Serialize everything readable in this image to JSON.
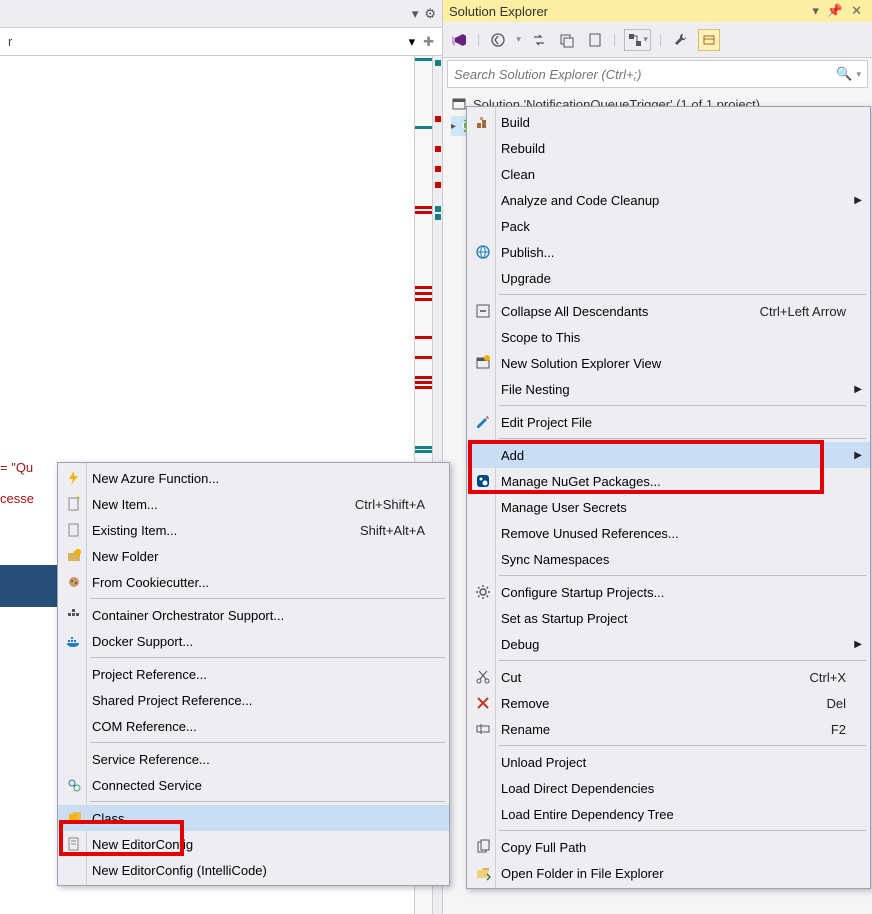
{
  "window": {
    "dropdown_chevron": "▾",
    "gear_icon": "⚙"
  },
  "nav": {
    "breadcrumb": "r",
    "plus": "✚"
  },
  "code": {
    "quote_fragment": "= \"Qu",
    "essed": "cesse"
  },
  "solution_explorer": {
    "title": "Solution Explorer",
    "search_placeholder": "Search Solution Explorer (Ctrl+;)",
    "solution_line": "Solution 'NotificationQueueTrigger' (1 of 1 project)"
  },
  "main_menu": {
    "build": "Build",
    "rebuild": "Rebuild",
    "clean": "Clean",
    "analyze": "Analyze and Code Cleanup",
    "pack": "Pack",
    "publish": "Publish...",
    "upgrade": "Upgrade",
    "collapse": "Collapse All Descendants",
    "collapse_sc": "Ctrl+Left Arrow",
    "scope": "Scope to This",
    "new_se_view": "New Solution Explorer View",
    "file_nesting": "File Nesting",
    "edit_proj": "Edit Project File",
    "add": "Add",
    "nuget": "Manage NuGet Packages...",
    "secrets": "Manage User Secrets",
    "remove_unused": "Remove Unused References...",
    "sync_ns": "Sync Namespaces",
    "cfg_startup": "Configure Startup Projects...",
    "set_startup": "Set as Startup Project",
    "debug": "Debug",
    "cut": "Cut",
    "cut_sc": "Ctrl+X",
    "remove": "Remove",
    "remove_sc": "Del",
    "rename": "Rename",
    "rename_sc": "F2",
    "unload": "Unload Project",
    "load_direct": "Load Direct Dependencies",
    "load_tree": "Load Entire Dependency Tree",
    "copy_path": "Copy Full Path",
    "open_explorer": "Open Folder in File Explorer"
  },
  "add_menu": {
    "new_azure": "New Azure Function...",
    "new_item": "New Item...",
    "new_item_sc": "Ctrl+Shift+A",
    "existing_item": "Existing Item...",
    "existing_item_sc": "Shift+Alt+A",
    "new_folder": "New Folder",
    "cookiecutter": "From Cookiecutter...",
    "container": "Container Orchestrator Support...",
    "docker": "Docker Support...",
    "proj_ref": "Project Reference...",
    "shared_ref": "Shared Project Reference...",
    "com_ref": "COM Reference...",
    "service_ref": "Service Reference...",
    "connected": "Connected Service",
    "class": "Class...",
    "editorconfig": "New EditorConfig",
    "editorconfig_ic": "New EditorConfig (IntelliCode)"
  }
}
